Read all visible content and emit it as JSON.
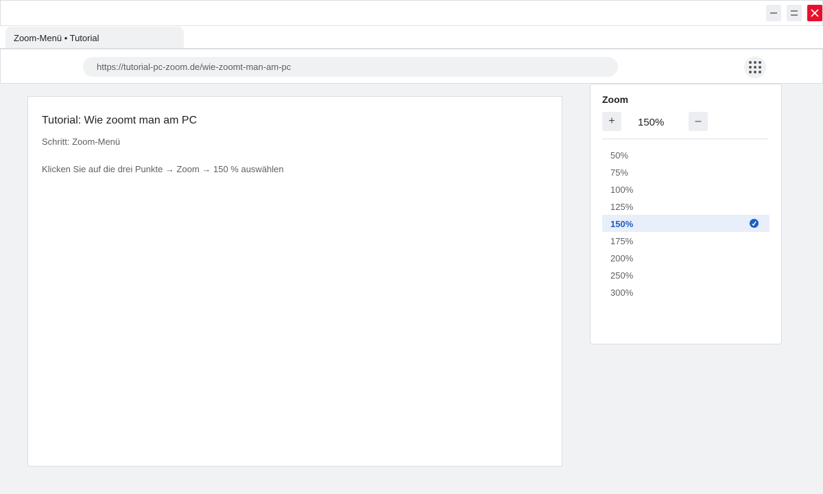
{
  "window": {
    "controls": [
      "minimize-icon",
      "maximize-icon",
      "close-icon"
    ],
    "close_color": "#e8112d"
  },
  "tab": {
    "title": "Zoom-Menü • Tutorial"
  },
  "address_bar": {
    "url": "https://tutorial-pc-zoom.de/wie-zoomt-man-am-pc"
  },
  "menu_button": {
    "icon": "grid-dots-icon"
  },
  "page": {
    "title": "Tutorial: Wie zoomt man am PC",
    "step": "Schritt: Zoom-Menü",
    "instruction": "Klicken Sie auf die drei Punkte → Zoom → 150 % auswählen"
  },
  "zoom_panel": {
    "title": "Zoom",
    "plus_label": "+",
    "minus_label": "–",
    "current_value": "150%",
    "options": [
      "50%",
      "75%",
      "100%",
      "125%",
      "150%",
      "175%",
      "200%",
      "250%",
      "300%"
    ],
    "selected_index": 4,
    "accent_color": "#1a5fc4"
  }
}
